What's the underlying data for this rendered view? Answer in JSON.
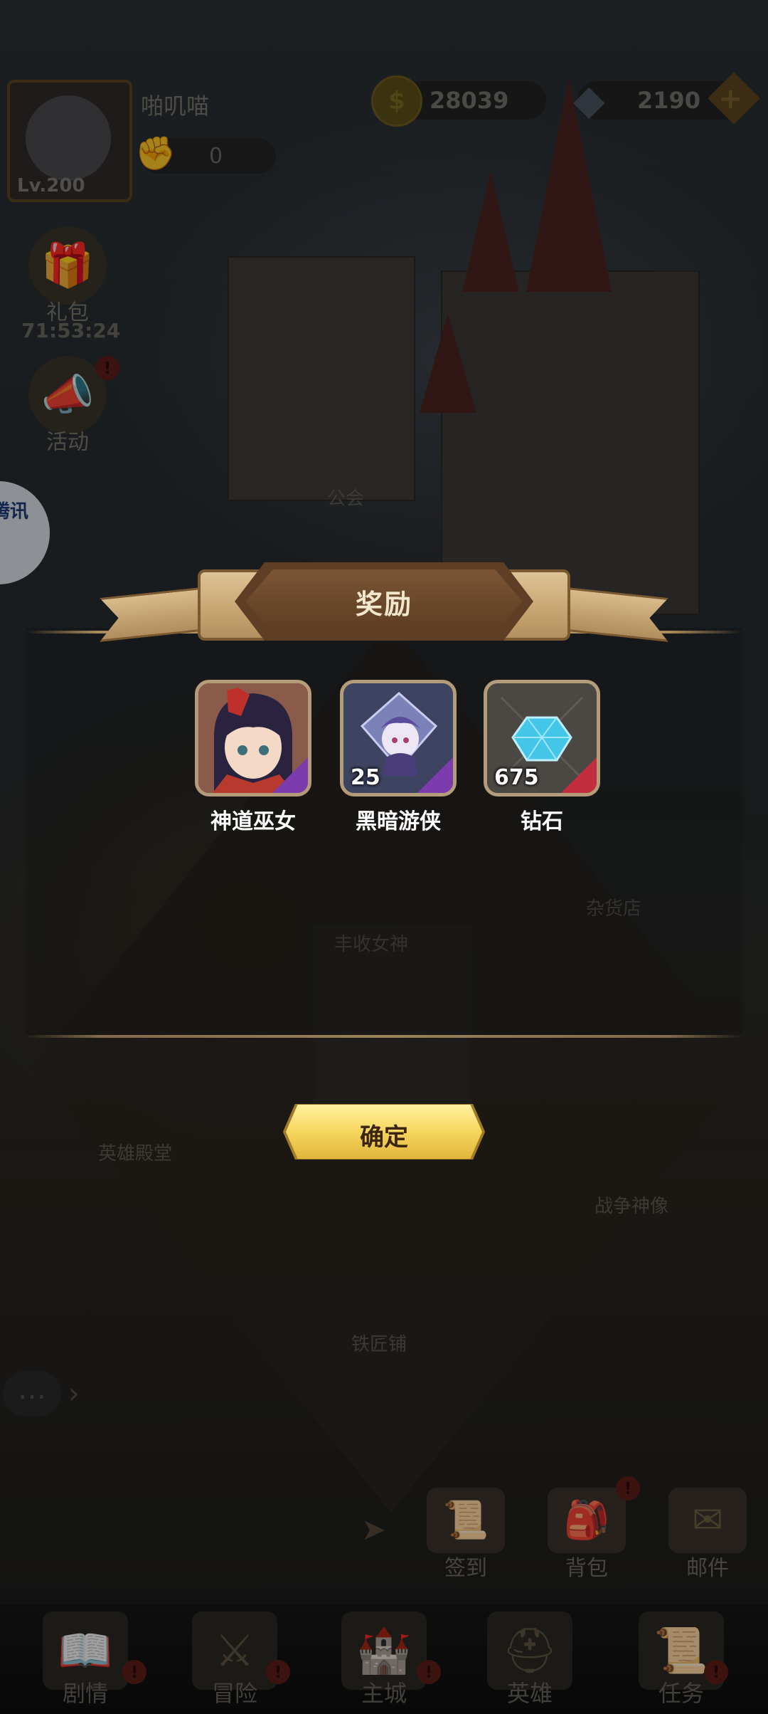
{
  "hud": {
    "player_name": "啪叽喵",
    "level": "Lv.200",
    "vip_count": "0",
    "gold": "28039",
    "diamonds": "2190",
    "gift_label": "礼包",
    "gift_timer": "71:53:24",
    "activity_label": "活动",
    "floating_badge": "腾讯"
  },
  "scene_labels": {
    "guild": "公会",
    "grocery": "杂货店",
    "harvest": "丰收女神",
    "hero_hall": "英雄殿堂",
    "war_statue": "战争神像",
    "blacksmith": "铁匠铺"
  },
  "quick_actions": [
    {
      "label": "签到",
      "icon": "scroll-icon"
    },
    {
      "label": "背包",
      "icon": "bag-icon"
    },
    {
      "label": "邮件",
      "icon": "mail-icon"
    }
  ],
  "nav": [
    {
      "label": "剧情",
      "icon": "book-icon"
    },
    {
      "label": "冒险",
      "icon": "swords-icon"
    },
    {
      "label": "主城",
      "icon": "castle-icon"
    },
    {
      "label": "英雄",
      "icon": "helmet-icon"
    },
    {
      "label": "任务",
      "icon": "quest-icon"
    }
  ],
  "modal": {
    "title": "奖励",
    "rewards": [
      {
        "name": "神道巫女",
        "qty": "",
        "rarity_color": "#7d3cae"
      },
      {
        "name": "黑暗游侠",
        "qty": "25",
        "rarity_color": "#7d3cae"
      },
      {
        "name": "钻石",
        "qty": "675",
        "rarity_color": "#c22e40"
      }
    ],
    "confirm_label": "确定"
  }
}
